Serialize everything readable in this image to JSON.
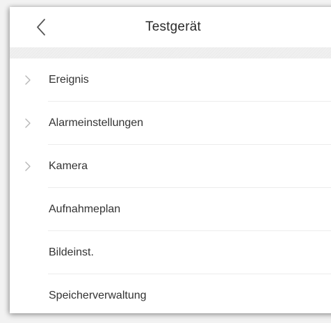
{
  "header": {
    "title": "Testgerät",
    "back_icon": "chevron-left-icon"
  },
  "menu": {
    "items": [
      {
        "label": "Ereignis",
        "expandable": true
      },
      {
        "label": "Alarmeinstellungen",
        "expandable": true
      },
      {
        "label": "Kamera",
        "expandable": true
      },
      {
        "label": "Aufnahmeplan",
        "expandable": false
      },
      {
        "label": "Bildeinst.",
        "expandable": false
      },
      {
        "label": "Speicherverwaltung",
        "expandable": false
      }
    ]
  },
  "colors": {
    "background": "#f2f2f2",
    "panel": "#ffffff",
    "text": "#333333",
    "chevron": "#b5b5b5",
    "divider": "#ececec"
  }
}
